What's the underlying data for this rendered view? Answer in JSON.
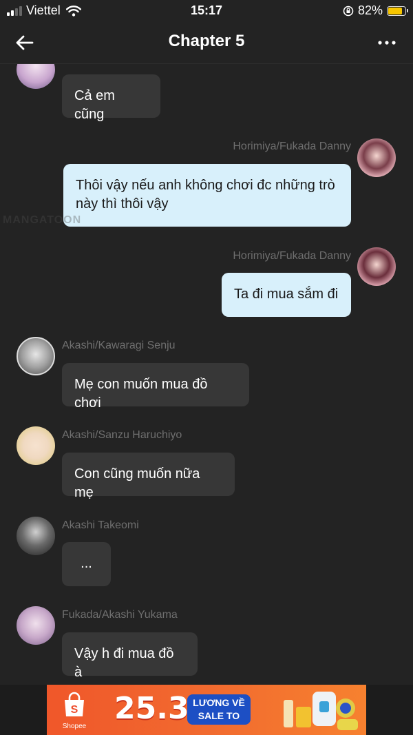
{
  "status_bar": {
    "carrier": "Viettel",
    "time": "15:17",
    "battery": "82%"
  },
  "header": {
    "title": "Chapter 5"
  },
  "messages": [
    {
      "side": "in",
      "sender": "",
      "text": "Cả em cũng"
    },
    {
      "side": "out",
      "sender": "Horimiya/Fukada Danny",
      "text": "Thôi vậy nếu anh không chơi đc những trò này thì thôi vậy"
    },
    {
      "side": "out",
      "sender": "Horimiya/Fukada Danny",
      "text": "Ta đi mua sắm đi"
    },
    {
      "side": "in",
      "sender": "Akashi/Kawaragi Senju",
      "text": "Mẹ con muốn mua đồ chơi"
    },
    {
      "side": "in",
      "sender": "Akashi/Sanzu Haruchiyo",
      "text": "Con cũng muốn nữa mẹ"
    },
    {
      "side": "in",
      "sender": "Akashi Takeomi",
      "text": "..."
    },
    {
      "side": "in",
      "sender": "Fukada/Akashi Yukama",
      "text": "Vậy h đi mua đồ à"
    }
  ],
  "watermark": "MANGATOON",
  "ad": {
    "brand": "Shopee",
    "date": "25.3",
    "line1": "LƯƠNG VỀ",
    "line2": "SALE TO"
  },
  "colors": {
    "background": "#232323",
    "bubble_in": "#373737",
    "bubble_out": "#d8f0fb",
    "sender": "#6f6f6f"
  }
}
